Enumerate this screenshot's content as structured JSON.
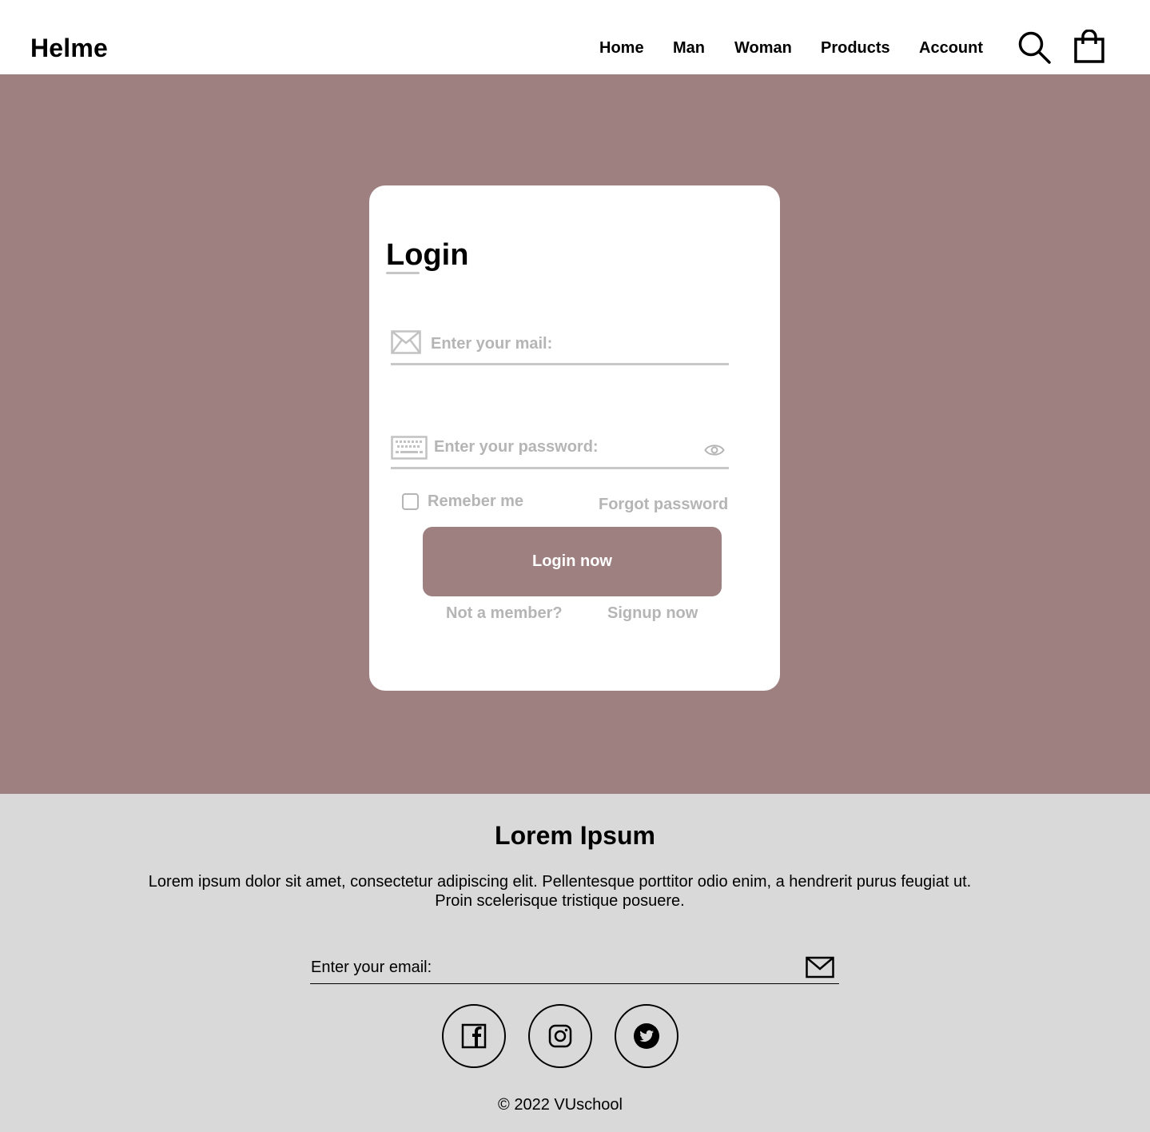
{
  "header": {
    "logo": "Helme",
    "nav": [
      "Home",
      "Man",
      "Woman",
      "Products",
      "Account"
    ],
    "icons": [
      "search-icon",
      "shopping-bag-icon"
    ]
  },
  "login": {
    "title": "Login",
    "email_placeholder": "Enter your mail:",
    "password_placeholder": "Enter your password:",
    "remember_label": "Remeber me",
    "remember_checked": false,
    "forgot_label": "Forgot password",
    "submit_label": "Login now",
    "not_member": "Not a member?",
    "signup_label": "Signup now",
    "icons": [
      "envelope-icon",
      "keyboard-icon",
      "eye-icon"
    ]
  },
  "footer": {
    "title": "Lorem Ipsum",
    "text_line1": "Lorem ipsum dolor sit amet, consectetur adipiscing elit. Pellentesque porttitor odio enim, a hendrerit purus feugiat ut.",
    "text_line2": "Proin scelerisque tristique posuere.",
    "email_placeholder": "Enter your email:",
    "social": [
      "facebook-icon",
      "instagram-icon",
      "twitter-icon"
    ],
    "copyright": "© 2022 VUschool"
  },
  "colors": {
    "accent": "#9f8081",
    "footer_bg": "#d9d9d9",
    "muted_text": "#b5b5b5",
    "card_bg": "#ffffff"
  }
}
